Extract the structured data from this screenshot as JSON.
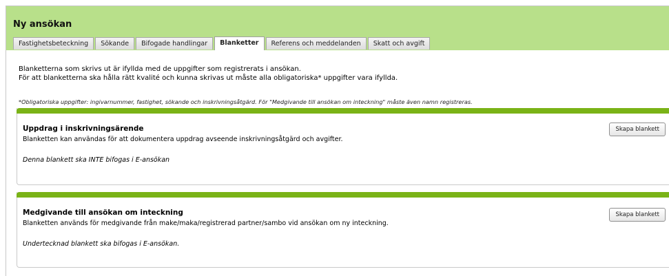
{
  "page": {
    "title": "Ny ansökan"
  },
  "tabs": [
    {
      "label": "Fastighetsbeteckning"
    },
    {
      "label": "Sökande"
    },
    {
      "label": "Bifogade handlingar"
    },
    {
      "label": "Blanketter",
      "active": true
    },
    {
      "label": "Referens och meddelanden"
    },
    {
      "label": "Skatt och avgift"
    }
  ],
  "intro": {
    "line1": "Blanketterna som skrivs ut är ifyllda med de uppgifter som registrerats i ansökan.",
    "line2": "För att blanketterna ska hålla rätt kvalité och kunna skrivas ut måste alla obligatoriska* uppgifter vara ifyllda.",
    "note": "*Obligatoriska uppgifter: ingivarnummer, fastighet, sökande och inskrivningsåtgärd. För \"Medgivande till ansökan om inteckning\" måste även namn registreras."
  },
  "cards": [
    {
      "title": "Uppdrag i inskrivningsärende",
      "description": "Blanketten kan användas för att dokumentera uppdrag avseende inskrivningsåtgärd och avgifter.",
      "note": "Denna blankett ska INTE bifogas i E-ansökan",
      "button": "Skapa blankett"
    },
    {
      "title": "Medgivande till ansökan om inteckning",
      "description": "Blanketten används för medgivande från make/maka/registrerad partner/sambo vid ansökan om ny inteckning.",
      "note": "Undertecknad blankett ska bifogas i E-ansökan.",
      "button": "Skapa blankett"
    }
  ],
  "colors": {
    "header_bg": "#b8e08a",
    "card_bar": "#7ab317"
  }
}
